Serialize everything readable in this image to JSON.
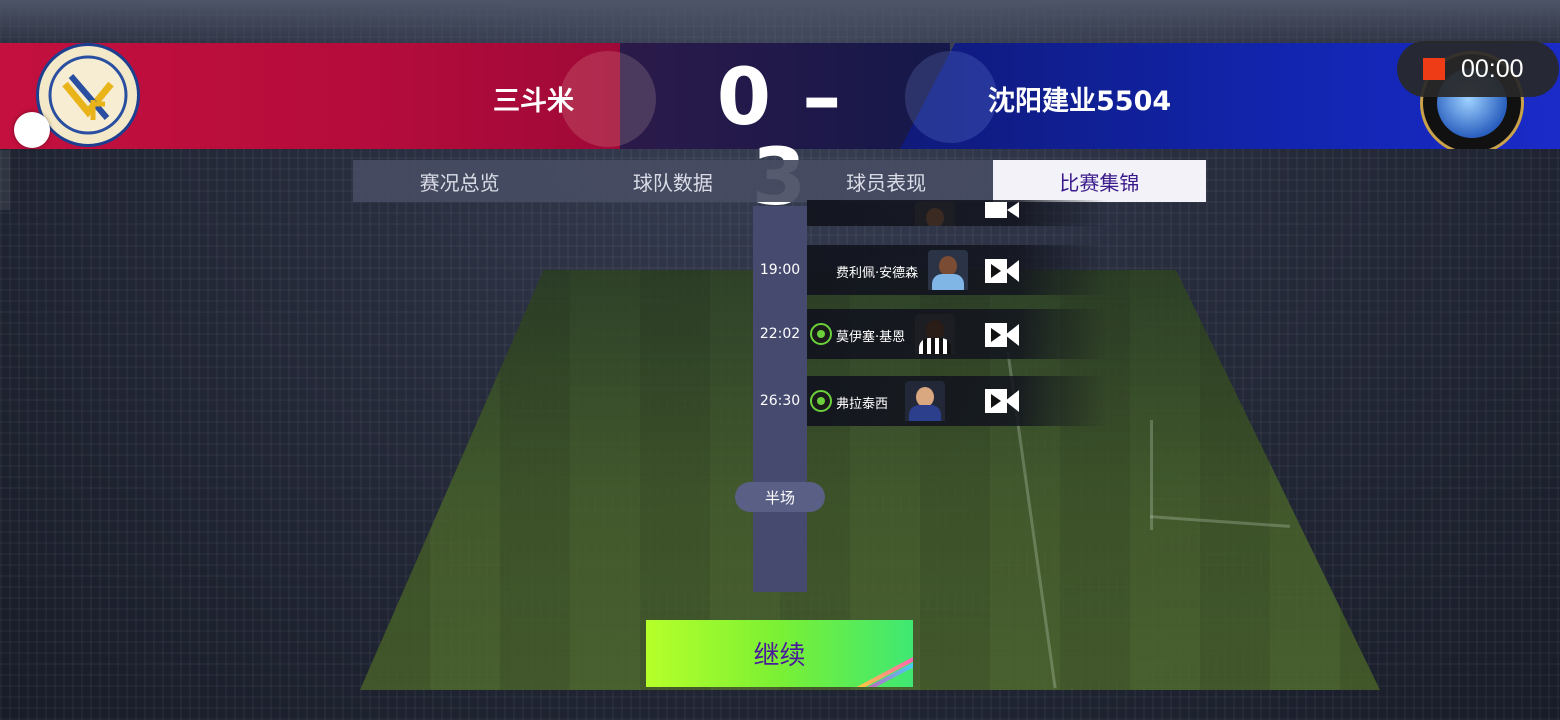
{
  "scoreboard": {
    "home_team": "三斗米",
    "away_team": "沈阳建业5504",
    "score": "0 – 3"
  },
  "recorder": {
    "time": "00:00",
    "icon": "stop-record-square"
  },
  "tabs": [
    {
      "label": "赛况总览",
      "active": false
    },
    {
      "label": "球队数据",
      "active": false
    },
    {
      "label": "球员表现",
      "active": false
    },
    {
      "label": "比赛集锦",
      "active": true
    }
  ],
  "events": [
    {
      "time": "19:00",
      "player": "费利佩·安德森",
      "type": "highlight"
    },
    {
      "time": "22:02",
      "player": "莫伊塞·基恩",
      "type": "goal"
    },
    {
      "time": "26:30",
      "player": "弗拉泰西",
      "type": "goal"
    }
  ],
  "timeline": {
    "half_label": "半场"
  },
  "actions": {
    "continue_label": "继续"
  },
  "colors": {
    "home_banner": "#c4103e",
    "away_banner": "#1225b0",
    "active_tab_text": "#3a1a8a",
    "continue_button": "#7af034",
    "goal_icon": "#6ad13a",
    "record_square": "#ee3d16"
  }
}
